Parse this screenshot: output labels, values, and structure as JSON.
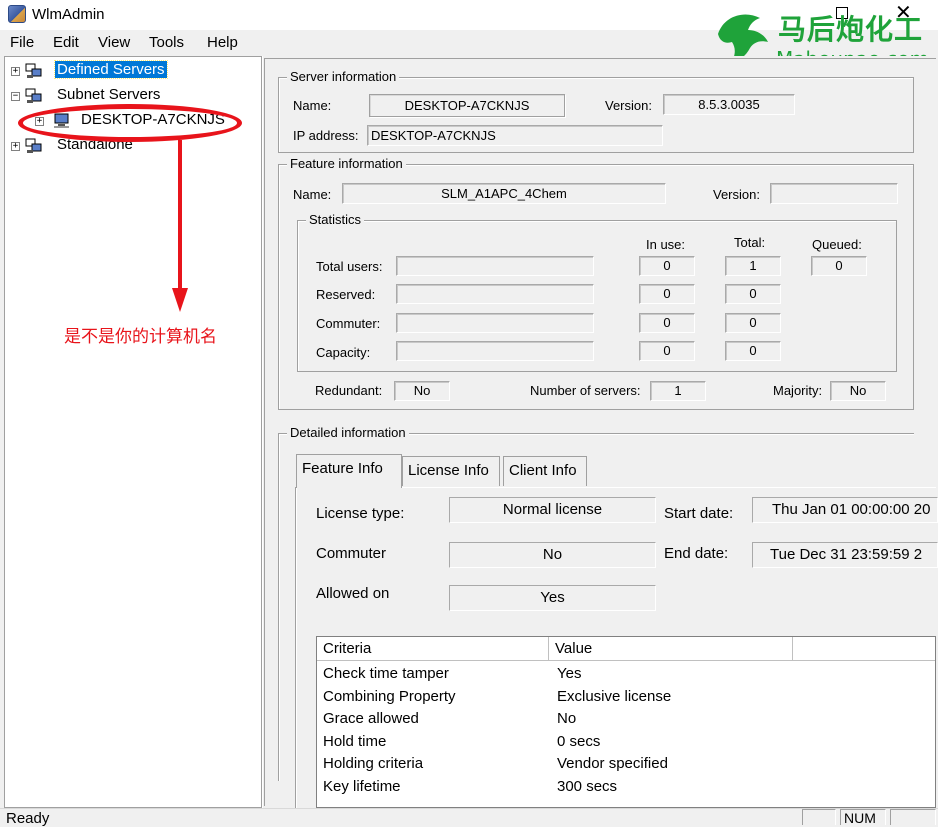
{
  "window": {
    "title": "WlmAdmin",
    "close_glyph": "✕"
  },
  "watermark": {
    "cn": "马后炮化工",
    "url": "Mahoupao.com"
  },
  "menu": [
    "File",
    "Edit",
    "View",
    "Tools",
    "Help"
  ],
  "tree": {
    "items": [
      {
        "label": "Defined Servers",
        "expander": "+"
      },
      {
        "label": "Subnet Servers",
        "expander": "−"
      },
      {
        "label": "DESKTOP-A7CKNJS",
        "expander": "+"
      },
      {
        "label": "Standalone",
        "expander": "+"
      }
    ]
  },
  "annotation": {
    "text": "是不是你的计算机名",
    "color": "#e8141b"
  },
  "server_info": {
    "legend": "Server information",
    "name_label": "Name:",
    "name": "DESKTOP-A7CKNJS",
    "version_label": "Version:",
    "version": "8.5.3.0035",
    "ip_label": "IP address:",
    "ip": "DESKTOP-A7CKNJS"
  },
  "feature_info": {
    "legend": "Feature information",
    "name_label": "Name:",
    "name": "SLM_A1APC_4Chem",
    "version_label": "Version:",
    "version": ""
  },
  "statistics": {
    "legend": "Statistics",
    "in_use_label": "In use:",
    "total_label": "Total:",
    "queued_label": "Queued:",
    "queued": "0",
    "rows": [
      {
        "label": "Total users:",
        "in_use": "0",
        "total": "1"
      },
      {
        "label": "Reserved:",
        "in_use": "0",
        "total": "0"
      },
      {
        "label": "Commuter:",
        "in_use": "0",
        "total": "0"
      },
      {
        "label": "Capacity:",
        "in_use": "0",
        "total": "0"
      }
    ],
    "redundant_label": "Redundant:",
    "redundant": "No",
    "servers_label": "Number of servers:",
    "servers": "1",
    "majority_label": "Majority:",
    "majority": "No"
  },
  "detailed": {
    "legend": "Detailed information",
    "tabs": [
      "Feature Info",
      "License Info",
      "Client Info"
    ],
    "license_type_label": "License type:",
    "license_type": "Normal license",
    "start_label": "Start date:",
    "start": "Thu Jan 01 00:00:00 20",
    "commuter_label": "Commuter",
    "commuter": "No",
    "end_label": "End date:",
    "end": "Tue Dec 31 23:59:59 2",
    "allowed_label": "Allowed on",
    "allowed": "Yes",
    "table": {
      "headers": [
        "Criteria",
        "Value"
      ],
      "rows": [
        [
          "Check time tamper",
          "Yes"
        ],
        [
          "Combining Property",
          "Exclusive license"
        ],
        [
          "Grace allowed",
          "No"
        ],
        [
          "Hold time",
          "0 secs"
        ],
        [
          "Holding criteria",
          "Vendor specified"
        ],
        [
          "Key lifetime",
          "300 secs"
        ]
      ]
    }
  },
  "status": {
    "text": "Ready",
    "num": "NUM"
  },
  "colors": {
    "selection": "#0078d7",
    "watermark": "#1fa33a",
    "annotation": "#e8141b"
  },
  "icons": [
    "app-icon",
    "server-icon",
    "close-icon",
    "horse-logo"
  ]
}
